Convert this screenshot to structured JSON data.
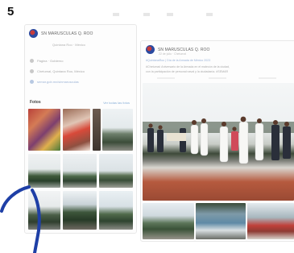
{
  "page": {
    "number": "5"
  },
  "left_card": {
    "profile_name": "SN MARUSCULAS Q. ROO",
    "subtitle": "Quintana Roo · México",
    "info_rows": [
      {
        "icon": "tag-icon",
        "text": "Página · Gobierno",
        "link": false
      },
      {
        "icon": "location-icon",
        "text": "Chetumal, Quintana Roo, México",
        "link": false
      },
      {
        "icon": "globe-icon",
        "text": "semar.gob.mx/sinmarusculas",
        "link": true
      }
    ],
    "photos_label": "Fotos",
    "photos_link": "Ver todas las fotos"
  },
  "post": {
    "profile_name": "SN MARUSCULAS Q. ROO",
    "meta": "22 de julio · Chetumal",
    "line1": "#QuintanaRoo | Día de la Armada de México 2023",
    "line2": "#Chetumal: Aniversario de la Armada en el malecón de la ciudad,",
    "line3": "con la participación de personal naval y la ciudadanía. #SEMAR"
  },
  "colors": {
    "pen_stroke": "#1e3fa6",
    "link": "#8ab0d8",
    "card_border": "#e8e8e8"
  }
}
